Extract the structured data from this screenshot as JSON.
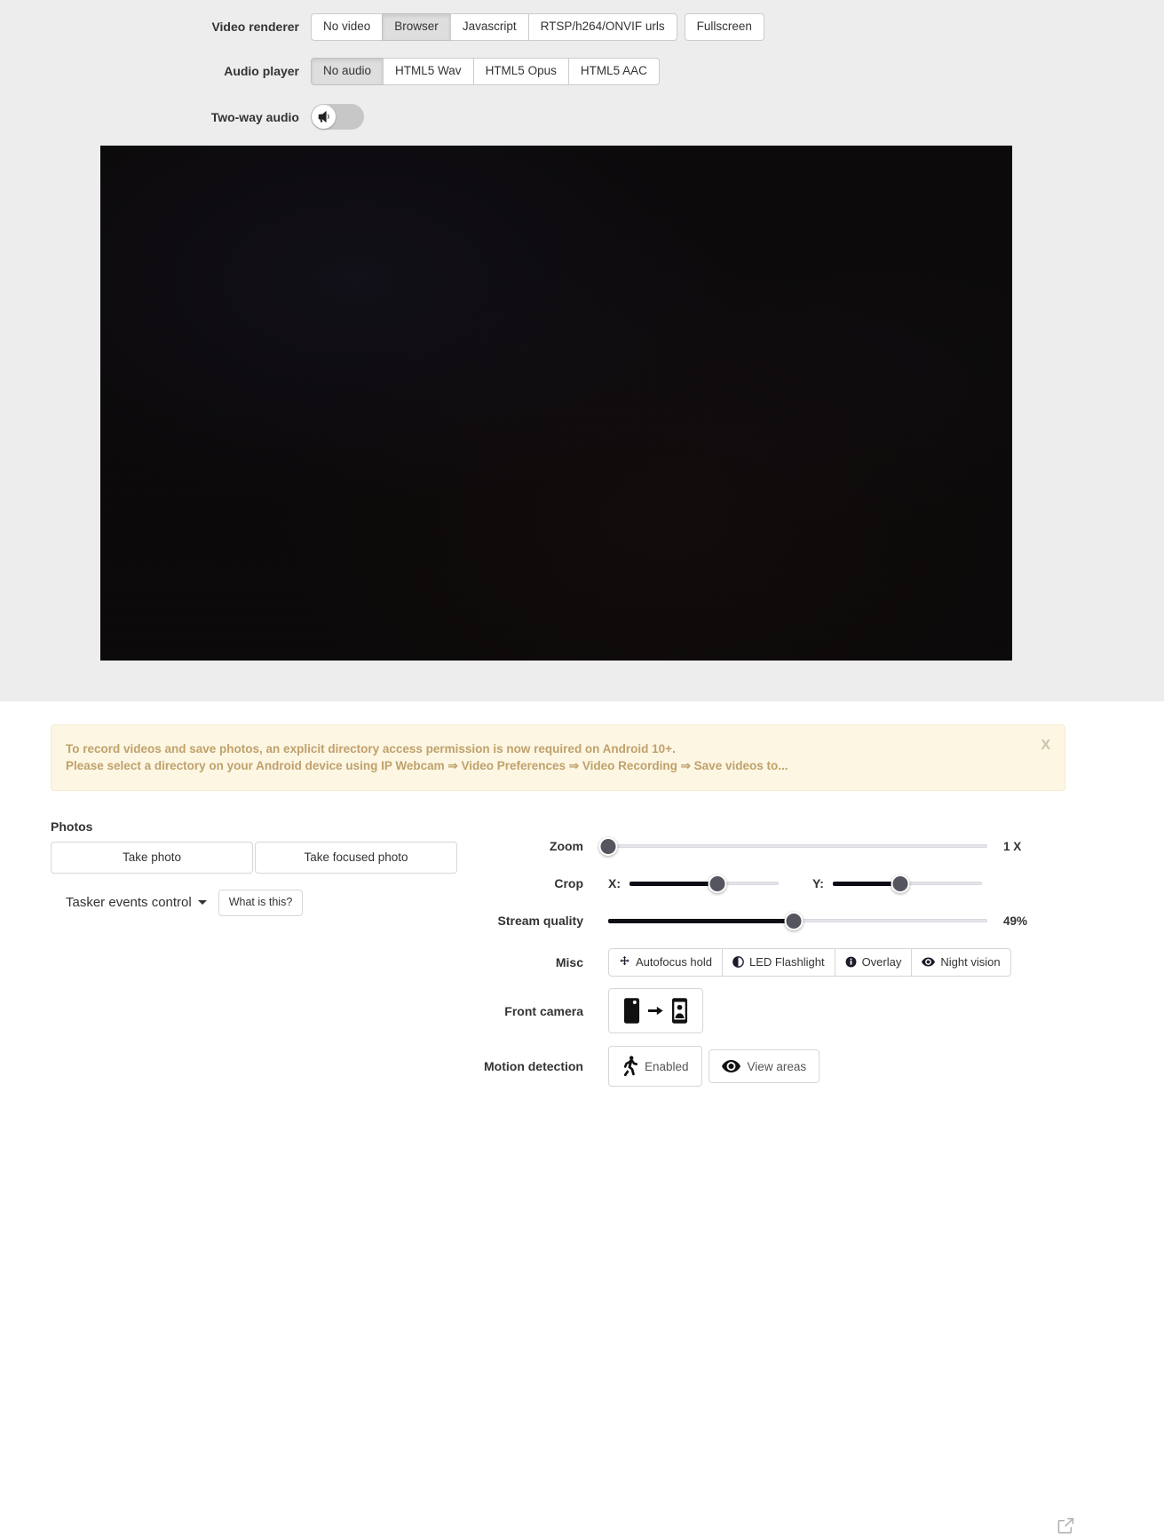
{
  "video_renderer": {
    "label": "Video renderer",
    "options": [
      "No video",
      "Browser",
      "Javascript",
      "RTSP/h264/ONVIF urls"
    ],
    "active": "Browser",
    "fullscreen_label": "Fullscreen"
  },
  "audio_player": {
    "label": "Audio player",
    "options": [
      "No audio",
      "HTML5 Wav",
      "HTML5 Opus",
      "HTML5 AAC"
    ],
    "active": "No audio"
  },
  "two_way_audio": {
    "label": "Two-way audio",
    "state": "off",
    "icon": "megaphone-icon"
  },
  "video_stage": {
    "name": "video-preview",
    "state": "dark"
  },
  "alert": {
    "line1": "To record videos and save photos, an explicit directory access permission is now required on Android 10+.",
    "line2": "Please select a directory on your Android device using IP Webcam ⇒ Video Preferences ⇒ Video Recording ⇒ Save videos to...",
    "close_label": "X",
    "color": "#c0a16b",
    "bg": "#fcf6e3"
  },
  "photos": {
    "title": "Photos",
    "take_photo": "Take photo",
    "take_focused_photo": "Take focused photo"
  },
  "tasker": {
    "label": "Tasker events control",
    "what_is_this": "What is this?"
  },
  "controls": {
    "zoom": {
      "label": "Zoom",
      "value_text": "1 X",
      "percent": 0
    },
    "crop": {
      "label": "Crop",
      "x_tag": "X:",
      "y_tag": "Y:",
      "x_percent": 59,
      "y_percent": 45
    },
    "stream_quality": {
      "label": "Stream quality",
      "value_text": "49%",
      "percent": 49
    },
    "misc": {
      "label": "Misc",
      "buttons": [
        {
          "text": "Autofocus hold",
          "icon": "arrows-alt-icon"
        },
        {
          "text": "LED Flashlight",
          "icon": "contrast-circle-icon"
        },
        {
          "text": "Overlay",
          "icon": "info-circle-icon"
        },
        {
          "text": "Night vision",
          "icon": "eye-icon"
        }
      ]
    },
    "front_camera": {
      "label": "Front camera",
      "icon_from": "phone-back-camera-icon",
      "icon_arrow": "arrow-right-icon",
      "icon_to": "phone-front-camera-icon"
    },
    "motion_detection": {
      "label": "Motion detection",
      "enabled_text": "Enabled",
      "enabled_icon": "running-person-icon",
      "view_areas_text": "View areas",
      "view_areas_icon": "eye-icon"
    },
    "external_link_icon": "external-link-icon"
  }
}
